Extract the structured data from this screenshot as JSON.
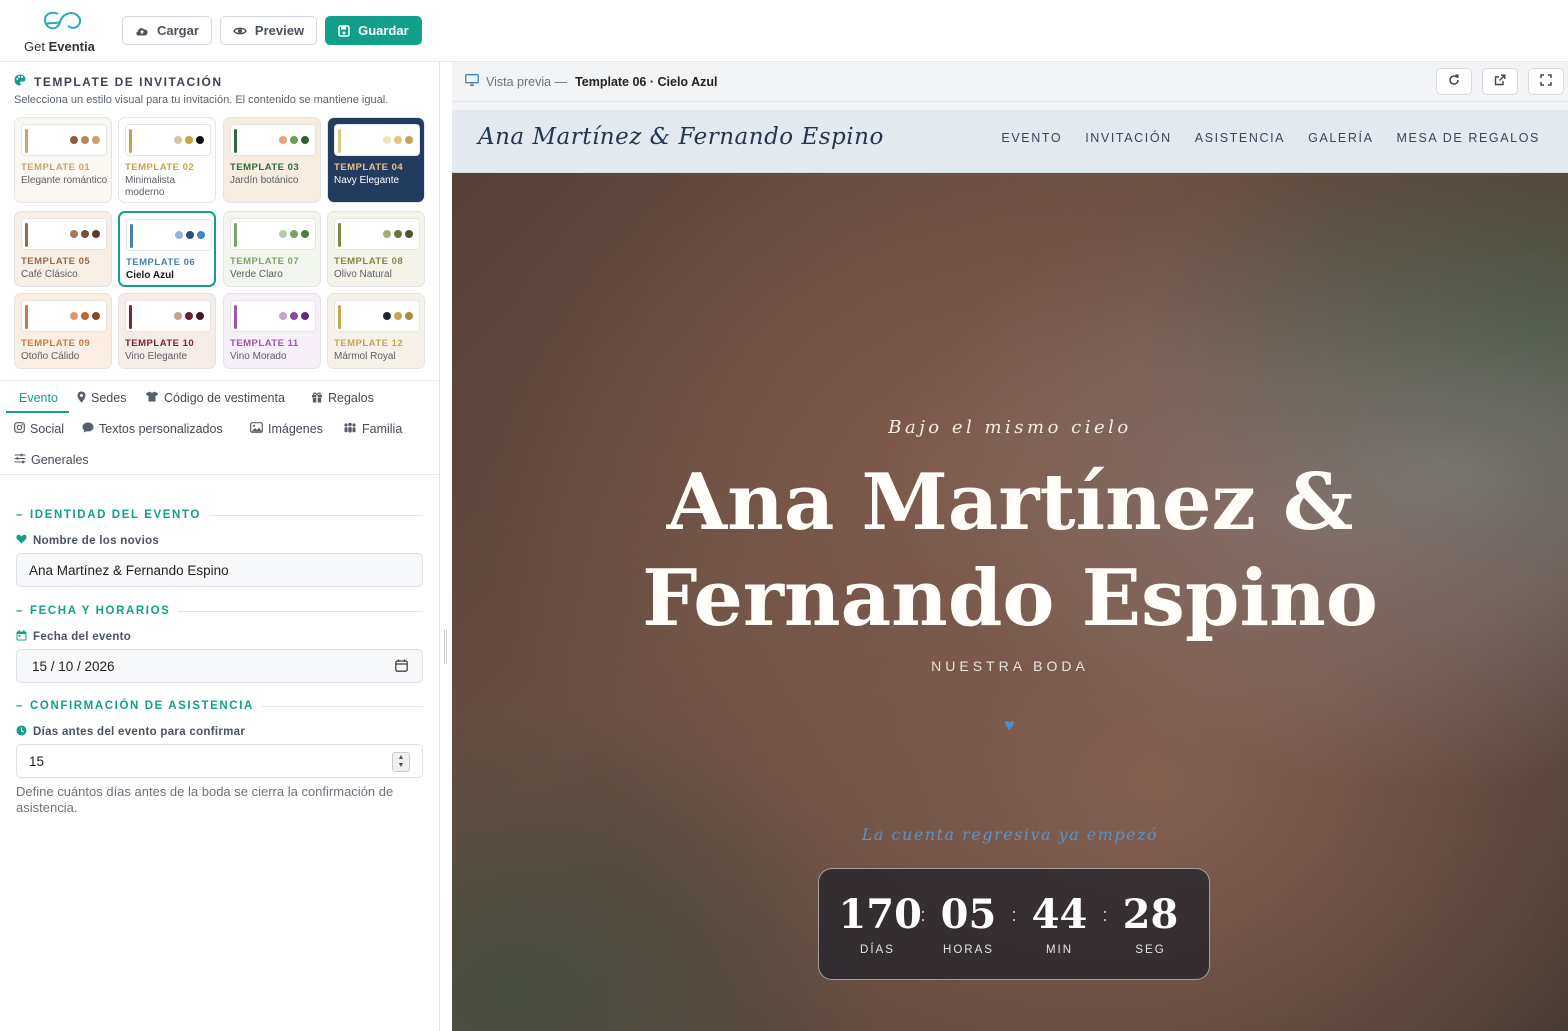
{
  "app": {
    "logo_prefix": "Get",
    "logo_brand": "Eventia",
    "buttons": {
      "load": "Cargar",
      "preview": "Preview",
      "save": "Guardar"
    }
  },
  "templates": {
    "title": "TEMPLATE DE INVITACIÓN",
    "subtitle": "Selecciona un estilo visual para tu invitación. El contenido se mantiene igual.",
    "items": [
      {
        "name": "TEMPLATE 01",
        "desc": "Elegante romántico",
        "bg": "#fbf8f3",
        "accent": "#c9a470",
        "dots": [
          "#8e5b4a",
          "#b08a5e",
          "#c8a372"
        ],
        "selected": false
      },
      {
        "name": "TEMPLATE 02",
        "desc": "Minimalista moderno",
        "bg": "#ffffff",
        "accent": "#c3a24a",
        "dots": [
          "#d8c79b",
          "#c7a53d",
          "#111111"
        ],
        "selected": false
      },
      {
        "name": "TEMPLATE 03",
        "desc": "Jardín botánico",
        "bg": "#f6ece0",
        "accent": "#2f6b3a",
        "dots": [
          "#e9a080",
          "#6b9a5a",
          "#2e5f36"
        ],
        "selected": false
      },
      {
        "name": "TEMPLATE 04",
        "desc": "Navy Elegante",
        "bg": "#243b60",
        "accent": "#e6c485",
        "dots": [
          "#f3e2b8",
          "#e6c485",
          "#c8a060"
        ],
        "selected": false
      },
      {
        "name": "TEMPLATE 05",
        "desc": "Café Clásico",
        "bg": "#f8efe6",
        "accent": "#9a6a4a",
        "dots": [
          "#a77a5a",
          "#7a4e36",
          "#5a3a2a"
        ],
        "selected": false
      },
      {
        "name": "TEMPLATE 06",
        "desc": "Cielo Azul",
        "bg": "#ffffff",
        "accent": "#4a7fb0",
        "dots": [
          "#8fb6de",
          "#2b4f7a",
          "#4a84c0"
        ],
        "selected": true
      },
      {
        "name": "TEMPLATE 07",
        "desc": "Verde Claro",
        "bg": "#f2f6ef",
        "accent": "#7ea46e",
        "dots": [
          "#b5cda6",
          "#7aa064",
          "#4f7a45"
        ],
        "selected": false
      },
      {
        "name": "TEMPLATE 08",
        "desc": "Olivo Natural",
        "bg": "#f5f3ea",
        "accent": "#7e8a4a",
        "dots": [
          "#a8ad76",
          "#6b7340",
          "#4c5530"
        ],
        "selected": false
      },
      {
        "name": "TEMPLATE 09",
        "desc": "Otoño Cálido",
        "bg": "#fbefe4",
        "accent": "#c87a42",
        "dots": [
          "#d99a6a",
          "#b8683a",
          "#8a4a2a"
        ],
        "selected": false
      },
      {
        "name": "TEMPLATE 10",
        "desc": "Vino Elegante",
        "bg": "#f6ece8",
        "accent": "#7a2530",
        "dots": [
          "#c9a08a",
          "#6a1f2a",
          "#4a1520"
        ],
        "selected": false
      },
      {
        "name": "TEMPLATE 11",
        "desc": "Vino Morado",
        "bg": "#f7f0f8",
        "accent": "#9a5aa8",
        "dots": [
          "#c8a0d0",
          "#8a4a9a",
          "#5e2f6a"
        ],
        "selected": false
      },
      {
        "name": "TEMPLATE 12",
        "desc": "Mármol Royal",
        "bg": "#f6f2ea",
        "accent": "#c9a456",
        "dots": [
          "#1e2430",
          "#c9a456",
          "#a88a4a"
        ],
        "selected": false
      }
    ]
  },
  "tabs": {
    "evento": "Evento",
    "sedes": "Sedes",
    "vestimenta": "Código de vestimenta",
    "regalos": "Regalos",
    "social": "Social",
    "textos": "Textos personalizados",
    "imagenes": "Imágenes",
    "familia": "Familia",
    "generales": "Generales"
  },
  "form": {
    "identity_section": "IDENTIDAD DEL EVENTO",
    "couple_label": "Nombre de los novios",
    "couple_value": "Ana Martínez & Fernando Espino",
    "date_section": "FECHA Y HORARIOS",
    "date_label": "Fecha del evento",
    "date_value": "15 / 10 / 2026",
    "rsvp_section": "CONFIRMACIÓN DE ASISTENCIA",
    "days_label": "Días antes del evento para confirmar",
    "days_value": "15",
    "help_text": "Define cuántos días antes de la boda se cierra la confirmación de asistencia."
  },
  "preview": {
    "label": "Vista previa —",
    "template": "Template 06 · Cielo Azul"
  },
  "site": {
    "brand": "Ana Martínez & Fernando Espino",
    "nav": [
      "EVENTO",
      "INVITACIÓN",
      "ASISTENCIA",
      "GALERÍA",
      "MESA DE REGALOS"
    ],
    "tagline": "Bajo el mismo cielo",
    "names_line1": "Ana Martínez &",
    "names_line2": "Fernando Espino",
    "subtitle": "NUESTRA BODA",
    "countdown_tag": "La cuenta regresiva ya empezó",
    "countdown": [
      {
        "value": "170",
        "label": "DÍAS"
      },
      {
        "value": "05",
        "label": "HORAS"
      },
      {
        "value": "44",
        "label": "MIN"
      },
      {
        "value": "28",
        "label": "SEG"
      }
    ]
  }
}
